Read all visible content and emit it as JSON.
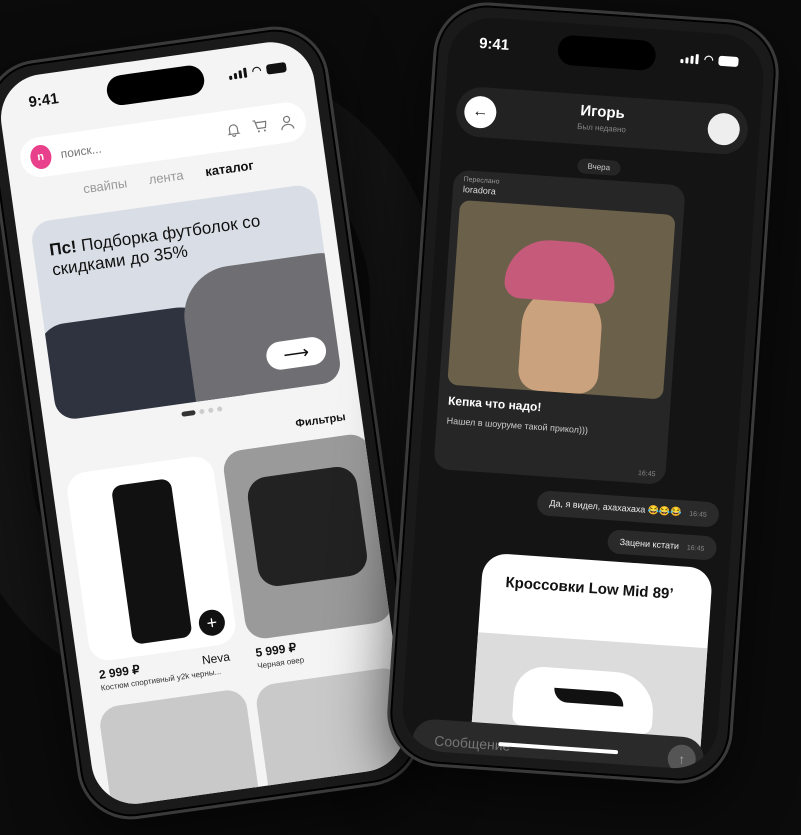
{
  "status": {
    "time": "9:41"
  },
  "shop": {
    "logo": "n",
    "search_placeholder": "поиск...",
    "tabs": [
      "свайпы",
      "лента",
      "каталог"
    ],
    "active_tab": "каталог",
    "banner": {
      "bold": "Пс!",
      "text": "Подборка футболок со скидками до 35%",
      "arrow": "⟶"
    },
    "filters_label": "Фильтры",
    "products": [
      {
        "price": "2 999 ₽",
        "brand": "Neva",
        "name": "Костюм спортивный y2k черны..."
      },
      {
        "price": "5 999 ₽",
        "brand": "",
        "name": "Черная овер"
      }
    ],
    "add_label": "+"
  },
  "chat": {
    "contact_name": "Игорь",
    "contact_status": "Был недавно",
    "back_label": "←",
    "date_label": "Вчера",
    "incoming": {
      "forwarded_label": "Переслано",
      "forwarded_from": "loradora",
      "title": "Кепка что надо!",
      "text": "Нашел в шоуруме такой прикол)))",
      "time": "16:45"
    },
    "outgoing": [
      {
        "text": "Да, я видел, ахахахаха 😂😂😂",
        "time": "16:45"
      },
      {
        "text": "Зацени кстати",
        "time": "16:45"
      }
    ],
    "product_card": {
      "title": "Кроссовки Low Mid 89’"
    },
    "input_placeholder": "Сообщение",
    "send_label": "↑"
  }
}
